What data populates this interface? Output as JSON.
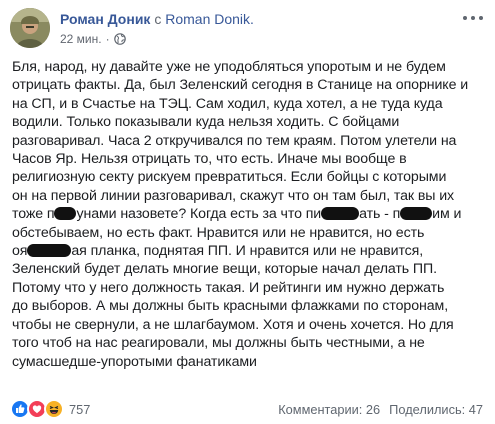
{
  "post": {
    "author": "Роман Доник",
    "with_text": " с ",
    "with_target": "Roman Donik.",
    "time": "22 мин.",
    "separator": "·",
    "privacy_icon": "globe-icon",
    "menu_icon": "more-dots-icon"
  },
  "body": {
    "lines": [
      "Бля, народ, ну давайте уже не уподобляться упоротым и не будем",
      "отрицать факты. Да, был Зеленский сегодня в Станице на опорнике и",
      "на СП, и в Счастье на ТЭЦ. Сам ходил, куда хотел, а не туда куда",
      "водили. Только показывали куда нельзя ходить. С бойцами",
      "разговаривал. Часа 2 откручивался по тем краям. Потом улетели на",
      "Часов Яр. Нельзя отрицать то, что есть. Иначе мы вообще в",
      "религиозную секту рискуем превратиться. Если бойцы с которыми",
      "он на первой линии разговаривал, скажут что он там был, так вы их",
      "тоже п",
      "унами назовете? Когда есть за что пи",
      "ать - п",
      "им и",
      "обстебываем, но есть факт. Нравится или не нравится, но есть",
      "оя",
      "ая планка, поднятая ПП. И нравится или не нравится,",
      "Зеленский будет делать многие вещи, которые начал делать ПП.",
      "Потому что у него должность такая. И рейтинги им нужно держать",
      "до выборов. А мы должны быть красными флажками по сторонам,",
      "чтобы не свернули, а не шлагбаумом. Хотя и очень хочется. Но для",
      "того чтоб на нас реагировали, мы должны быть честными, а не",
      "сумасшедше-упоротыми фанатиками"
    ]
  },
  "footer": {
    "reactions": [
      "like-icon",
      "love-icon",
      "haha-icon"
    ],
    "reaction_count": "757",
    "comments": "Комментарии: 26",
    "shares": "Поделились: 47"
  },
  "colors": {
    "link": "#385898",
    "text": "#1c1e21",
    "secondary": "#616770",
    "like": "#1877f2",
    "love": "#f33e58",
    "haha": "#f7b125"
  }
}
